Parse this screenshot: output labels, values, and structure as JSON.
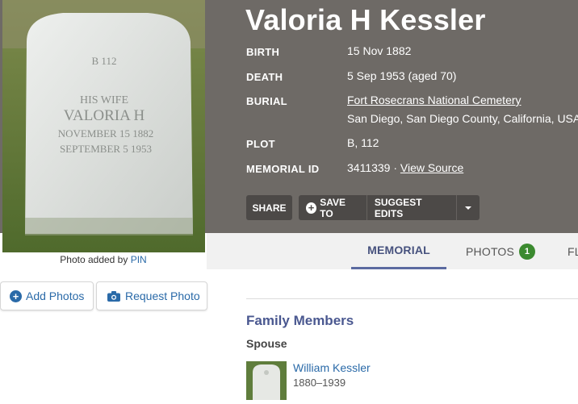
{
  "memorial": {
    "name": "Valoria H Kessler",
    "photo_caption_prefix": "Photo added by",
    "photo_caption_user": "PIN",
    "headstone": {
      "line1": "B 112",
      "line2": "HIS WIFE",
      "line3": "VALORIA H",
      "line4": "NOVEMBER 15 1882",
      "line5": "SEPTEMBER 5 1953"
    }
  },
  "facts": {
    "birth_label": "BIRTH",
    "birth_value": "15 Nov 1882",
    "death_label": "DEATH",
    "death_value": "5 Sep 1953 (aged 70)",
    "burial_label": "BURIAL",
    "burial_cemetery": "Fort Rosecrans National Cemetery",
    "burial_location": "San Diego, San Diego County, California, USA",
    "plot_label": "PLOT",
    "plot_value": "B, 112",
    "memorial_id_label": "MEMORIAL ID",
    "memorial_id_value": "3411339 ·",
    "view_source": "View Source"
  },
  "actions": {
    "share": "SHARE",
    "save_to": "SAVE TO",
    "suggest_edits": "SUGGEST EDITS"
  },
  "tabs": {
    "memorial": "MEMORIAL",
    "photos": "PHOTOS",
    "photos_count": "1",
    "flowers": "FL"
  },
  "buttons": {
    "add_photos": "Add Photos",
    "request_photo": "Request Photo"
  },
  "family": {
    "title": "Family Members",
    "spouse_heading": "Spouse",
    "spouse_name": "William Kessler",
    "spouse_dates": "1880–1939"
  },
  "colors": {
    "header_bg": "#6e6a66",
    "link_blue": "#2a6aa8",
    "accent_purple": "#5b6aa0",
    "badge_green": "#3b8a2f"
  }
}
